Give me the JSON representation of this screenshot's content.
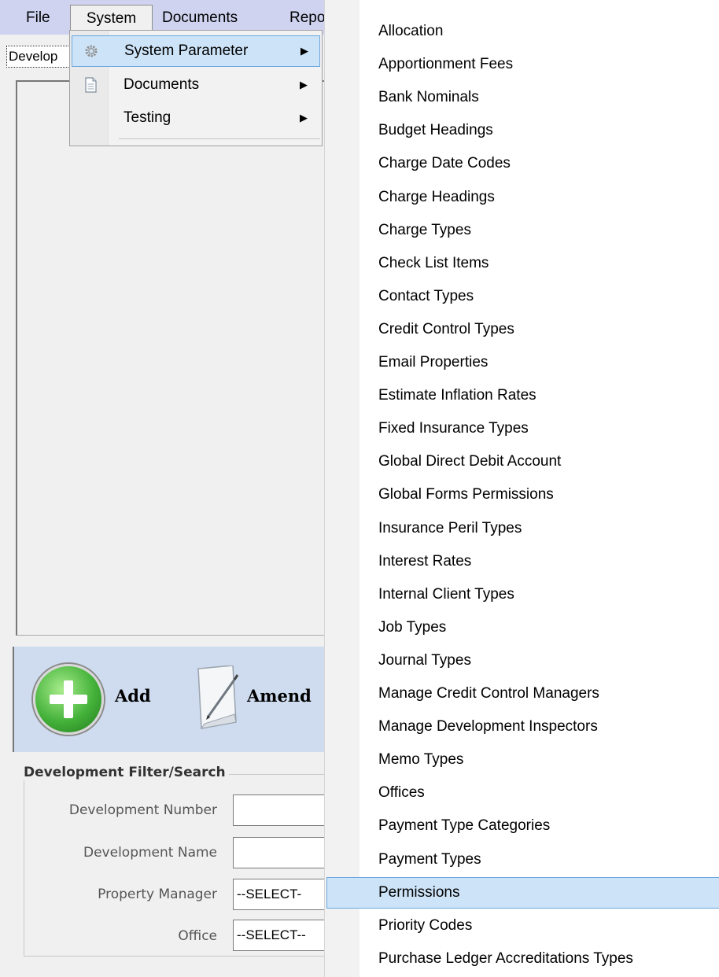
{
  "menubar": {
    "file": "File",
    "system": "System",
    "documents": "Documents",
    "reports_partial": "Repo"
  },
  "tab": {
    "label": "Develop"
  },
  "toolbar": {
    "add": "Add",
    "amend": "Amend"
  },
  "filter": {
    "title": "Development Filter/Search",
    "number_label": "Development Number",
    "name_label": "Development Name",
    "manager_label": "Property Manager",
    "manager_value": "--SELECT-",
    "office_label": "Office",
    "office_value": "--SELECT--"
  },
  "system_menu": {
    "items": [
      {
        "label": "System Parameter",
        "icon": "gear-icon",
        "submenu": true,
        "highlighted": true
      },
      {
        "label": "Documents",
        "icon": "document-icon",
        "submenu": true
      },
      {
        "label": "Testing",
        "icon": "",
        "submenu": true
      }
    ]
  },
  "submenu": {
    "highlighted": "Permissions",
    "items": [
      "Allocation",
      "Apportionment Fees",
      "Bank Nominals",
      "Budget Headings",
      "Charge Date Codes",
      "Charge Headings",
      "Charge Types",
      "Check List Items",
      "Contact Types",
      "Credit Control Types",
      "Email Properties",
      "Estimate Inflation Rates",
      "Fixed Insurance Types",
      "Global Direct Debit Account",
      "Global Forms Permissions",
      "Insurance Peril Types",
      "Interest Rates",
      "Internal Client Types",
      "Job Types",
      "Journal Types",
      "Manage Credit Control Managers",
      "Manage Development Inspectors",
      "Memo Types",
      "Offices",
      "Payment Type Categories",
      "Payment Types",
      "Permissions",
      "Priority Codes",
      "Purchase Ledger Accreditations Types"
    ]
  }
}
